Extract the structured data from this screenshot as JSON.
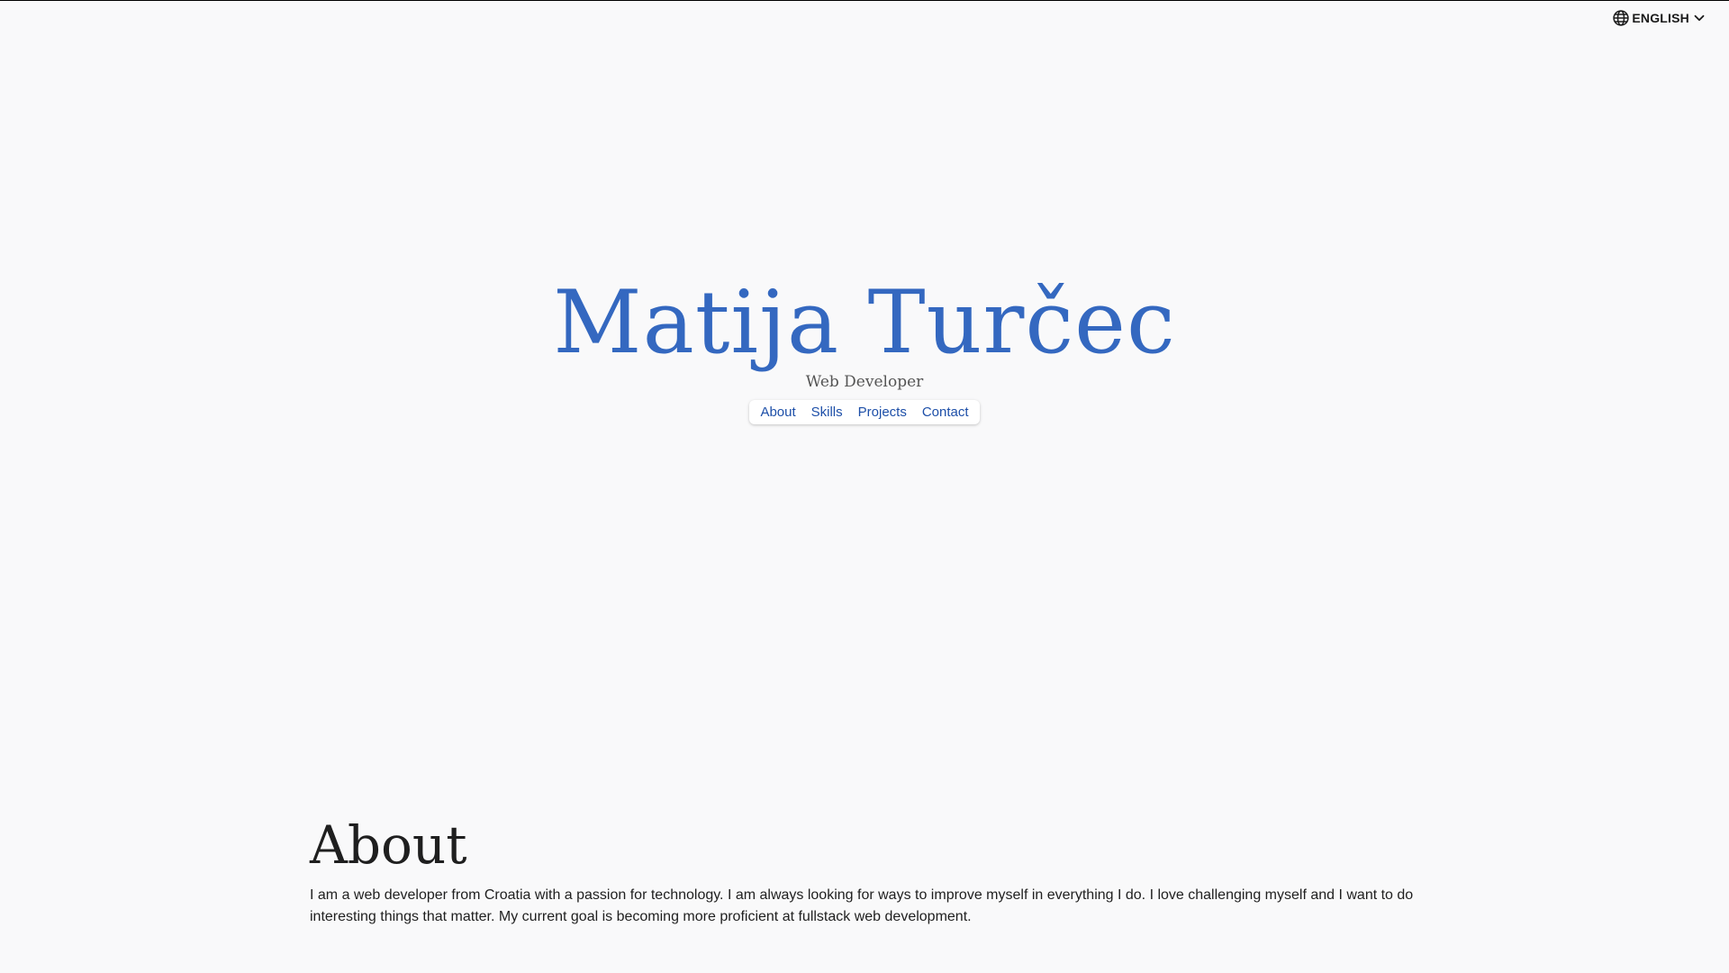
{
  "colors": {
    "accent": "#3468c0",
    "nav_link": "#1d4fa8",
    "background": "#f9f9fa",
    "text": "#1f1f1f"
  },
  "language_selector": {
    "icon": "globe-icon",
    "label": "ENGLISH",
    "chevron_icon": "chevron-down-icon"
  },
  "hero": {
    "name": "Matija Turčec",
    "subtitle": "Web Developer",
    "nav": [
      {
        "label": "About"
      },
      {
        "label": "Skills"
      },
      {
        "label": "Projects"
      },
      {
        "label": "Contact"
      }
    ]
  },
  "about": {
    "title": "About",
    "text": "I am a web developer from Croatia with a passion for technology. I am always looking for ways to improve myself in everything I do. I love challenging myself and I want to do interesting things that matter. My current goal is becoming more proficient at fullstack web development."
  }
}
